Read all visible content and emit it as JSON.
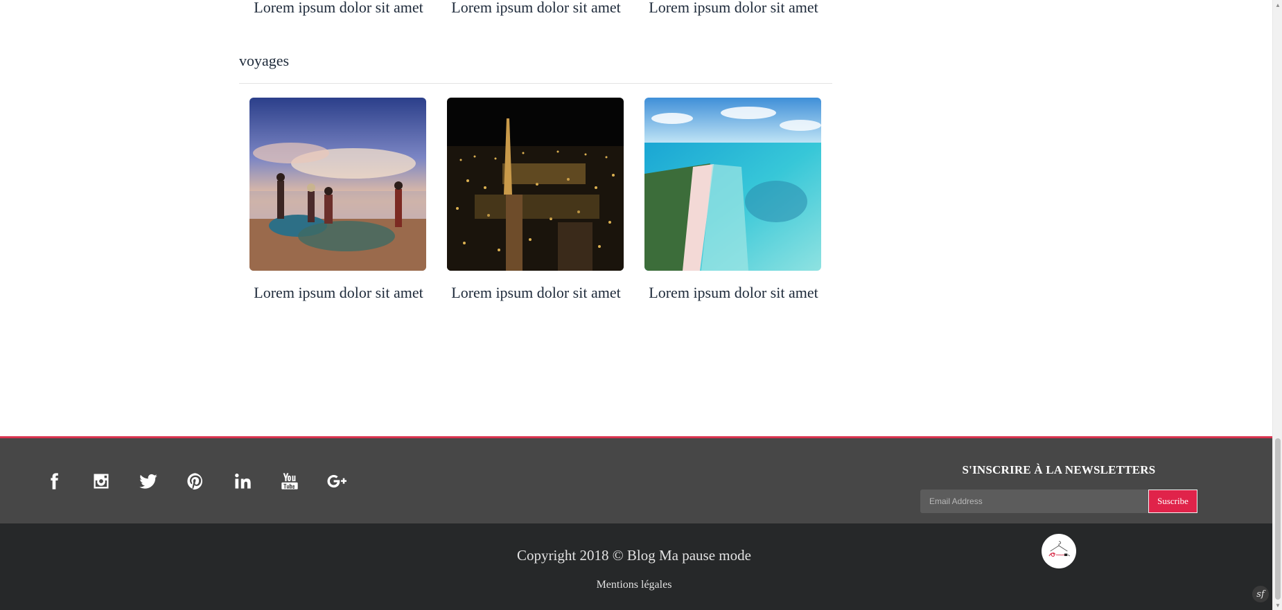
{
  "top_row": {
    "captions": [
      "Lorem ipsum dolor sit amet",
      "Lorem ipsum dolor sit amet",
      "Lorem ipsum dolor sit amet"
    ]
  },
  "section": {
    "title": "voyages",
    "cards": [
      {
        "caption": "Lorem ipsum dolor sit amet",
        "image": "fishermen-at-sunset-photo"
      },
      {
        "caption": "Lorem ipsum dolor sit amet",
        "image": "city-at-night-photo"
      },
      {
        "caption": "Lorem ipsum dolor sit amet",
        "image": "tropical-beach-aerial-photo"
      }
    ]
  },
  "footer": {
    "accent_color": "#d9334f",
    "social_icons": [
      "facebook-icon",
      "instagram-icon",
      "twitter-icon",
      "pinterest-icon",
      "linkedin-icon",
      "youtube-icon",
      "google-plus-icon"
    ],
    "newsletter": {
      "title": "S'INSCRIRE À LA NEWSLETTERS",
      "email_placeholder": "Email Address",
      "button_label": "Suscribe",
      "button_color": "#e0234a"
    },
    "copyright": "Copyright 2018 © Blog Ma pause mode",
    "legal_link": "Mentions légales",
    "symfony_badge": "sf"
  }
}
